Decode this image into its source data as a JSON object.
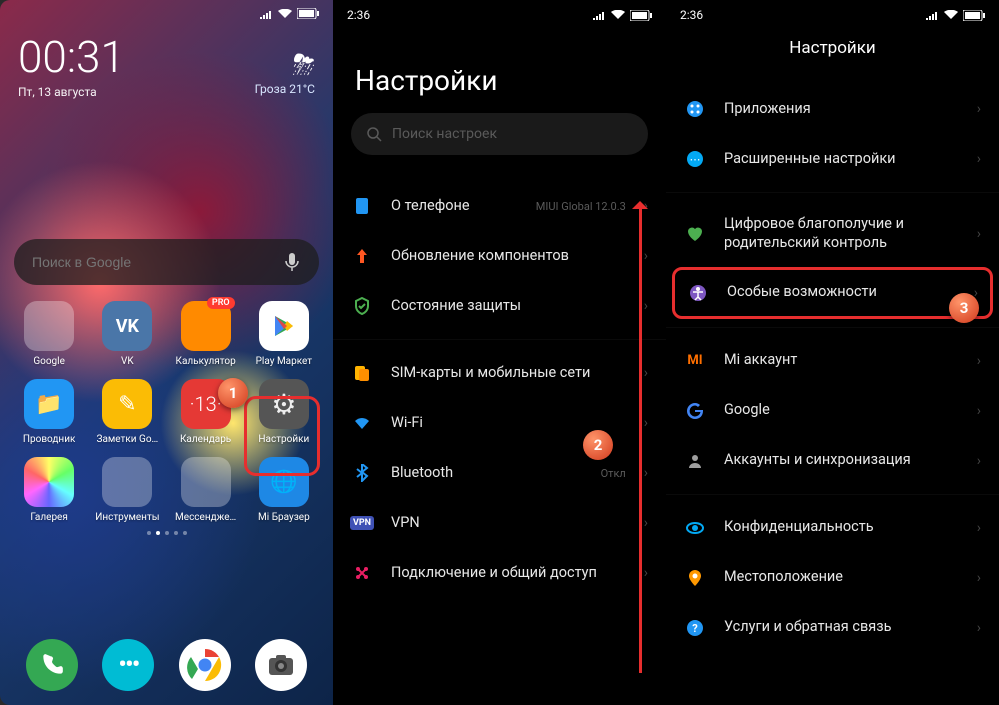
{
  "phone1": {
    "status_time": "00:31",
    "clock": "00:31",
    "date": "Пт, 13 августа",
    "weather_icon": "⛈",
    "weather_text": "Гроза  21°C",
    "search_placeholder": "Поиск в Google",
    "apps_row1": [
      {
        "label": "Google",
        "type": "folder"
      },
      {
        "label": "VK",
        "bg": "#4a76a8",
        "glyph": "VK"
      },
      {
        "label": "Калькулятор",
        "bg": "#ff8a00",
        "badge": "PRO"
      },
      {
        "label": "Play Маркет",
        "bg": "#fff",
        "glyph": "▶"
      }
    ],
    "apps_row2": [
      {
        "label": "Проводник",
        "bg": "#2196f3",
        "glyph": "📁"
      },
      {
        "label": "Заметки Go…",
        "bg": "#fbbc05",
        "glyph": "✎"
      },
      {
        "label": "Календарь",
        "bg": "#e53935",
        "glyph": "13"
      },
      {
        "label": "Настройки",
        "bg": "#555",
        "glyph": "⚙"
      }
    ],
    "apps_row3": [
      {
        "label": "Галерея",
        "bg": "",
        "type": "gallery"
      },
      {
        "label": "Инструменты",
        "type": "folder"
      },
      {
        "label": "Мессендже…",
        "type": "folder"
      },
      {
        "label": "Mi Браузер",
        "bg": "#1e88e5",
        "glyph": "🌐"
      }
    ],
    "dock": [
      {
        "name": "phone-icon",
        "bg": "#34a853",
        "glyph": "phone"
      },
      {
        "name": "messages-icon",
        "bg": "#00bcd4",
        "glyph": "msg"
      },
      {
        "name": "chrome-icon",
        "bg": "#fff",
        "glyph": "chrome"
      },
      {
        "name": "camera-icon",
        "bg": "#fff",
        "glyph": "camera"
      }
    ],
    "callout": "1"
  },
  "phone2": {
    "status_time": "2:36",
    "title": "Настройки",
    "search_placeholder": "Поиск настроек",
    "groups": [
      [
        {
          "id": "about",
          "icon_color": "#2196f3",
          "label": "О телефоне",
          "sub": "MIUI Global 12.0.3"
        },
        {
          "id": "update",
          "icon_color": "#ff5722",
          "label": "Обновление компонентов"
        },
        {
          "id": "security",
          "icon_color": "#4caf50",
          "label": "Состояние защиты"
        }
      ],
      [
        {
          "id": "sim",
          "icon_color": "#ffb300",
          "label": "SIM-карты и мобильные сети"
        },
        {
          "id": "wifi",
          "icon_color": "#2196f3",
          "label": "Wi-Fi",
          "sub": ""
        },
        {
          "id": "bt",
          "icon_color": "#2196f3",
          "label": "Bluetooth",
          "sub": "Откл"
        },
        {
          "id": "vpn",
          "icon_color": "#3f51b5",
          "label": "VPN"
        },
        {
          "id": "sharing",
          "icon_color": "#e91e63",
          "label": "Подключение и общий доступ"
        }
      ]
    ],
    "callout": "2"
  },
  "phone3": {
    "status_time": "2:36",
    "title": "Настройки",
    "groups": [
      [
        {
          "id": "apps",
          "icon_color": "#2196f3",
          "label": "Приложения"
        },
        {
          "id": "advanced",
          "icon_color": "#03a9f4",
          "label": "Расширенные настройки"
        }
      ],
      [
        {
          "id": "wellbeing",
          "icon_color": "#4caf50",
          "label": "Цифровое благополучие и родительский контроль"
        },
        {
          "id": "access",
          "icon_color": "#7e57c2",
          "label": "Особые возможности",
          "highlight": true
        }
      ],
      [
        {
          "id": "mi",
          "icon_color": "#ff6f00",
          "label": "Mi аккаунт",
          "sub": ""
        },
        {
          "id": "google",
          "icon_color": "",
          "label": "Google"
        },
        {
          "id": "sync",
          "icon_color": "#9e9e9e",
          "label": "Аккаунты и синхронизация"
        }
      ],
      [
        {
          "id": "privacy",
          "icon_color": "#03a9f4",
          "label": "Конфиденциальность"
        },
        {
          "id": "location",
          "icon_color": "#ff9800",
          "label": "Местоположение"
        },
        {
          "id": "feedback",
          "icon_color": "#2196f3",
          "label": "Услуги и обратная связь"
        }
      ]
    ],
    "callout": "3"
  }
}
